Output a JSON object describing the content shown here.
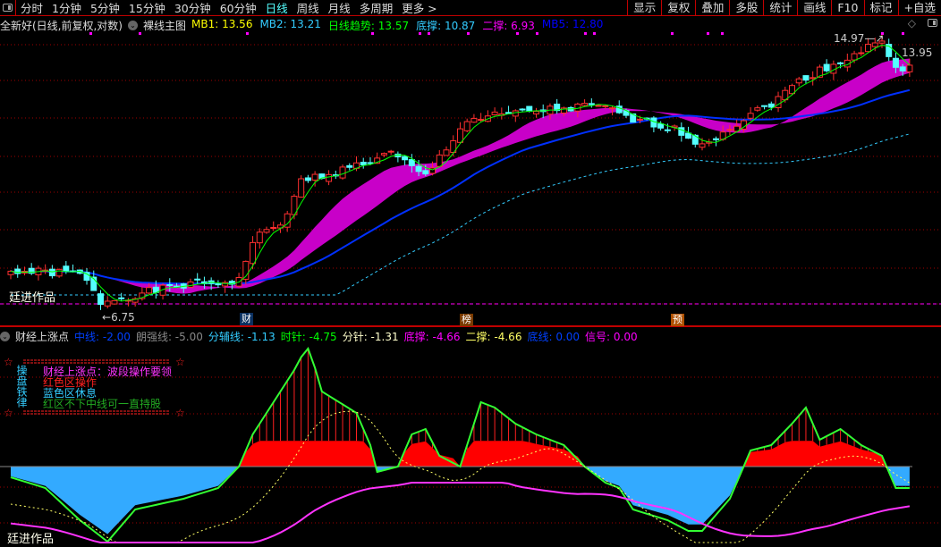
{
  "toolbar": {
    "periods": [
      "分时",
      "1分钟",
      "5分钟",
      "15分钟",
      "30分钟",
      "60分钟",
      "日线",
      "周线",
      "月线",
      "多周期",
      "更多 >"
    ],
    "active": "日线",
    "buttons": [
      "显示",
      "复权",
      "叠加",
      "多股",
      "统计",
      "画线",
      "F10",
      "标记",
      "+自选"
    ]
  },
  "main": {
    "stock": "全新好(日线,前复权,对数)",
    "indicator": "裸线主图",
    "values": [
      {
        "label": "MB1: 13.56",
        "color": "#ffff00"
      },
      {
        "label": "MB2: 13.21",
        "color": "#33ccff"
      },
      {
        "label": "日线趋势: 13.57",
        "color": "#00ff00"
      },
      {
        "label": "底撑: 10.87",
        "color": "#33ccff"
      },
      {
        "label": "二撑: 6.93",
        "color": "#ff00ff"
      },
      {
        "label": "MB5: 12.80",
        "color": "#0000ff"
      }
    ],
    "high_label": "14.97",
    "low_label": "6.75",
    "last_label": "13.95",
    "watermark": "廷进作品",
    "tags": [
      "财",
      "榜",
      "预"
    ]
  },
  "sub": {
    "indicator": "财经上涨点",
    "values": [
      {
        "label": "中线: -2.00",
        "color": "#0040ff"
      },
      {
        "label": "朗强线: -5.00",
        "color": "#888888"
      },
      {
        "label": "分辅线: -1.13",
        "color": "#33ccff"
      },
      {
        "label": "时针: -4.75",
        "color": "#00ff00"
      },
      {
        "label": "分针: -1.31",
        "color": "#ffffcc"
      },
      {
        "label": "底撑: -4.66",
        "color": "#ff00ff"
      },
      {
        "label": "二撑: -4.66",
        "color": "#ffff66"
      },
      {
        "label": "底线: 0.00",
        "color": "#0040ff"
      },
      {
        "label": "信号: 0.00",
        "color": "#ff00ff"
      }
    ],
    "rules_title": "操盘铁律",
    "rules": [
      "财经上涨点：波段操作要领",
      "红色区操作",
      "蓝色区休息",
      "红区不下中线可一直持股"
    ],
    "watermark": "廷进作品"
  },
  "colors": {
    "up": "#ff3030",
    "down": "#54ffff",
    "ma": "#00ff00",
    "band": "#c800c8",
    "ma_blue": "#0030ff",
    "grid": "#a00000"
  },
  "chart_data": {
    "type": "candlestick",
    "count": 131,
    "close_keypoints": [
      [
        0,
        7.6
      ],
      [
        10,
        7.55
      ],
      [
        13,
        6.95
      ],
      [
        18,
        7.1
      ],
      [
        25,
        7.3
      ],
      [
        30,
        7.35
      ],
      [
        33,
        7.4
      ],
      [
        35,
        8.3
      ],
      [
        40,
        8.9
      ],
      [
        42,
        9.9
      ],
      [
        48,
        10.2
      ],
      [
        55,
        10.7
      ],
      [
        60,
        10.0
      ],
      [
        66,
        11.8
      ],
      [
        75,
        12.1
      ],
      [
        85,
        12.3
      ],
      [
        90,
        11.8
      ],
      [
        95,
        11.6
      ],
      [
        100,
        11.0
      ],
      [
        105,
        11.7
      ],
      [
        110,
        12.4
      ],
      [
        115,
        13.4
      ],
      [
        120,
        14.0
      ],
      [
        126,
        14.9
      ],
      [
        128,
        13.6
      ],
      [
        130,
        13.95
      ]
    ],
    "price_high": 14.97,
    "price_low": 6.75,
    "osc_keypoints": [
      [
        0,
        -1
      ],
      [
        5,
        -2
      ],
      [
        10,
        -5
      ],
      [
        14,
        -7
      ],
      [
        18,
        -4
      ],
      [
        25,
        -3
      ],
      [
        30,
        -2
      ],
      [
        33,
        0
      ],
      [
        35,
        3
      ],
      [
        38,
        6
      ],
      [
        41,
        9
      ],
      [
        43,
        11.4
      ],
      [
        45,
        7
      ],
      [
        50,
        5
      ],
      [
        52,
        2
      ],
      [
        53,
        -0.5
      ],
      [
        56,
        0
      ],
      [
        58,
        3
      ],
      [
        60,
        3.5
      ],
      [
        62,
        1
      ],
      [
        65,
        0
      ],
      [
        68,
        6
      ],
      [
        70,
        5.5
      ],
      [
        73,
        4
      ],
      [
        76,
        3
      ],
      [
        80,
        2
      ],
      [
        83,
        0
      ],
      [
        86,
        -1.5
      ],
      [
        88,
        -2
      ],
      [
        90,
        -4
      ],
      [
        95,
        -5
      ],
      [
        98,
        -6
      ],
      [
        100,
        -6
      ],
      [
        104,
        -3
      ],
      [
        107,
        1.5
      ],
      [
        110,
        2
      ],
      [
        113,
        4
      ],
      [
        115,
        5.5
      ],
      [
        117,
        2.5
      ],
      [
        120,
        3.5
      ],
      [
        123,
        2
      ],
      [
        126,
        1
      ],
      [
        128,
        -2
      ],
      [
        130,
        -2
      ]
    ]
  }
}
